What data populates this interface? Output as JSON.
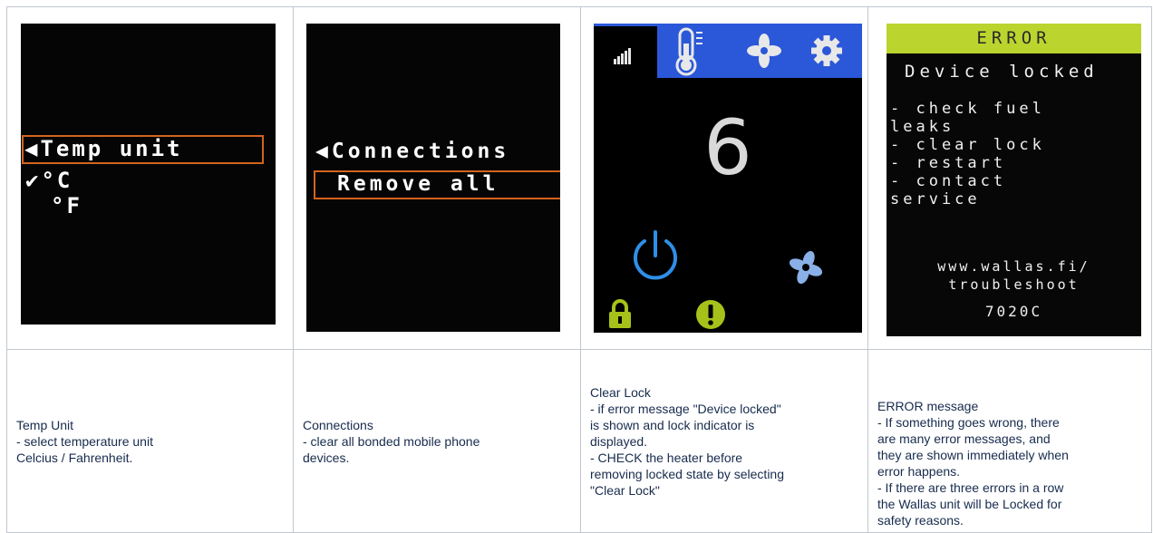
{
  "screens": {
    "temp_unit": {
      "title": "Temp unit",
      "options": [
        "°C",
        "°F"
      ],
      "selected": "°C"
    },
    "connections": {
      "title": "Connections",
      "item": "Remove all"
    },
    "main": {
      "value": "6"
    },
    "error": {
      "header": "ERROR",
      "title": "Device locked",
      "lines": [
        "- check fuel",
        "leaks",
        "- clear lock",
        "- restart",
        "- contact",
        "service"
      ],
      "url_line1": "www.wallas.fi/",
      "url_line2": "troubleshoot",
      "code": "7020C"
    }
  },
  "colors": {
    "highlight_border": "#d2641e",
    "tab_blue": "#2b58d8",
    "icon_green": "#a6c21a",
    "power_blue": "#2f8fe8",
    "error_bar": "#bcd42e"
  },
  "descriptions": [
    {
      "title": "Temp Unit",
      "lines": [
        "- select temperature unit",
        "Celcius / Fahrenheit."
      ]
    },
    {
      "title": "Connections",
      "lines": [
        "- clear all bonded mobile phone",
        "devices."
      ]
    },
    {
      "title": "Clear Lock",
      "lines": [
        "- if error message \"Device locked\"",
        "is shown and lock indicator is",
        "displayed.",
        "- CHECK the heater before",
        "removing locked state by selecting",
        "\"Clear Lock\""
      ]
    },
    {
      "title": "ERROR message",
      "lines": [
        "- If something goes wrong, there",
        "are many error messages, and",
        "they are shown immediately when",
        "error happens.",
        "- If there are three errors in a row",
        "the Wallas unit will be Locked for",
        "safety reasons."
      ]
    }
  ]
}
